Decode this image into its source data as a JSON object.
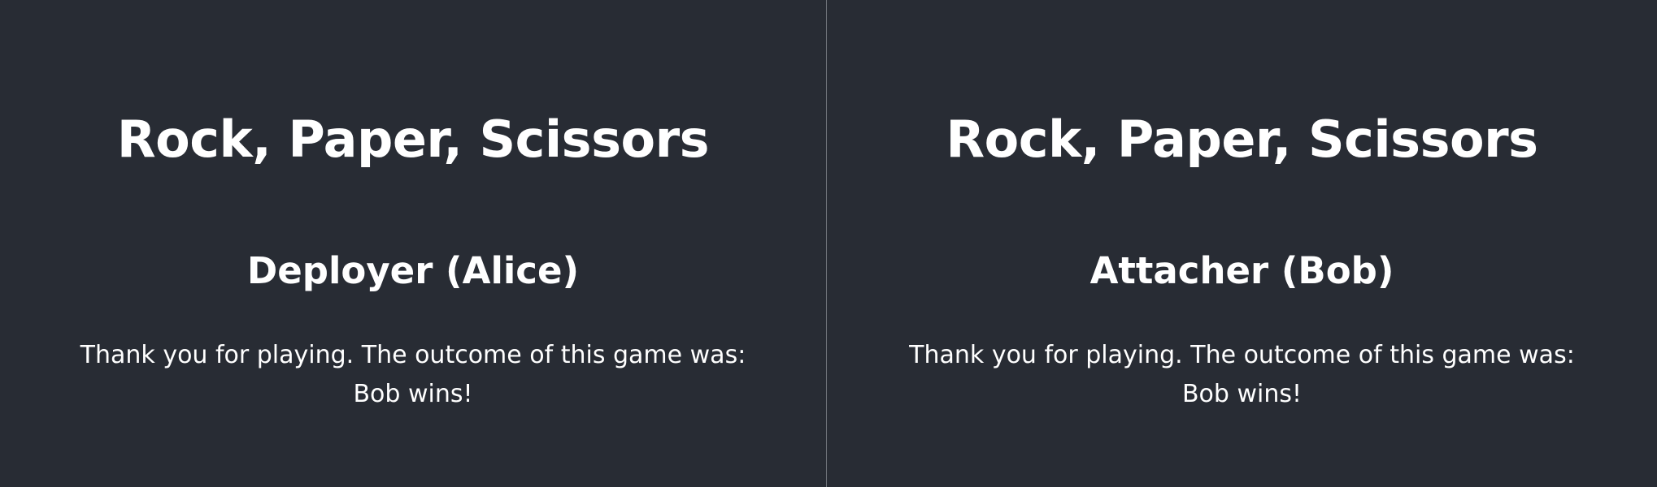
{
  "panes": [
    {
      "title": "Rock, Paper, Scissors",
      "role": "Deployer (Alice)",
      "message_line_1": "Thank you for playing. The outcome of this game was:",
      "message_line_2": "Bob wins!"
    },
    {
      "title": "Rock, Paper, Scissors",
      "role": "Attacher (Bob)",
      "message_line_1": "Thank you for playing. The outcome of this game was:",
      "message_line_2": "Bob wins!"
    }
  ],
  "colors": {
    "background": "#282c34",
    "text": "#ffffff",
    "divider": "#6f737a"
  }
}
